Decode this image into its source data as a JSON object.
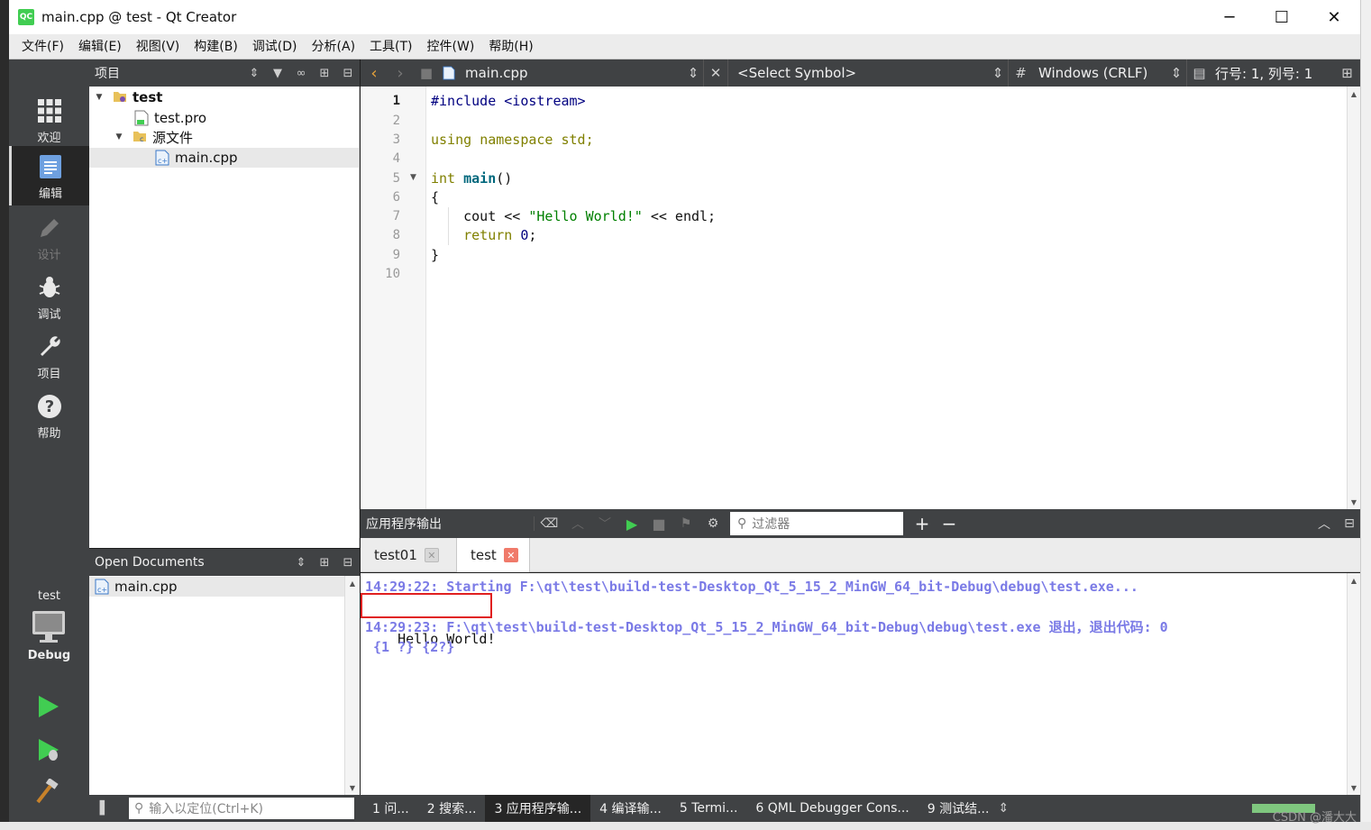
{
  "window": {
    "title": "main.cpp @ test - Qt Creator",
    "logo": "QC",
    "minimize": "─",
    "maximize": "☐",
    "close": "✕"
  },
  "menu": [
    "文件(F)",
    "编辑(E)",
    "视图(V)",
    "构建(B)",
    "调试(D)",
    "分析(A)",
    "工具(T)",
    "控件(W)",
    "帮助(H)"
  ],
  "modes": [
    {
      "label": "欢迎",
      "icon": "grid-icon"
    },
    {
      "label": "编辑",
      "icon": "edit-document-icon"
    },
    {
      "label": "设计",
      "icon": "pencil-icon"
    },
    {
      "label": "调试",
      "icon": "bug-icon"
    },
    {
      "label": "项目",
      "icon": "wrench-icon"
    },
    {
      "label": "帮助",
      "icon": "help-icon"
    }
  ],
  "kit": {
    "project": "test",
    "config": "Debug"
  },
  "projects_pane": {
    "title": "项目",
    "tree": [
      {
        "label": "test"
      },
      {
        "label": "test.pro"
      },
      {
        "label": "源文件"
      },
      {
        "label": "main.cpp"
      }
    ]
  },
  "open_documents": {
    "title": "Open Documents",
    "items": [
      "main.cpp"
    ]
  },
  "editor": {
    "file": "main.cpp",
    "symbol": "<Select Symbol>",
    "hash": "#",
    "line_ending": "Windows (CRLF)",
    "position": "行号: 1, 列号: 1",
    "line_numbers": [
      "1",
      "2",
      "3",
      "4",
      "5",
      "6",
      "7",
      "8",
      "9",
      "10"
    ],
    "code": {
      "l1_pp": "#include <iostream>",
      "l3_kw1": "using",
      "l3_kw2": "namespace",
      "l3_rest": "std;",
      "l5_kw": "int",
      "l5_fn": "main",
      "l5_rest": "()",
      "l6": "{",
      "l7_a": "    cout << ",
      "l7_str": "\"Hello World!\"",
      "l7_b": " << endl;",
      "l8_kw": "    return",
      "l8_num": "0",
      "l8_rest": ";",
      "l9": "}"
    }
  },
  "output_pane": {
    "title": "应用程序输出",
    "filter_placeholder": "过滤器",
    "plus": "+",
    "minus": "−",
    "tabs": [
      {
        "label": "test01"
      },
      {
        "label": "test"
      }
    ],
    "lines": [
      "14:29:22: Starting F:\\qt\\test\\build-test-Desktop_Qt_5_15_2_MinGW_64_bit-Debug\\debug\\test.exe...",
      "Hello World!",
      "14:29:23: F:\\qt\\test\\build-test-Desktop_Qt_5_15_2_MinGW_64_bit-Debug\\debug\\test.exe 退出，退出代码: 0",
      " {1 ?} {2?}"
    ]
  },
  "statusbar": {
    "locator_placeholder": "输入以定位(Ctrl+K)",
    "panes": [
      "1 问...",
      "2 搜索...",
      "3 应用程序输...",
      "4 编译输...",
      "5 Termi...",
      "6 QML Debugger Cons...",
      "9 测试结..."
    ]
  },
  "watermark": "CSDN @潘大大",
  "colors": {
    "sidebar": "#404244",
    "accent_green": "#41cd52",
    "output_sys": "#7a7ae6",
    "highlight_box": "#e02020"
  }
}
